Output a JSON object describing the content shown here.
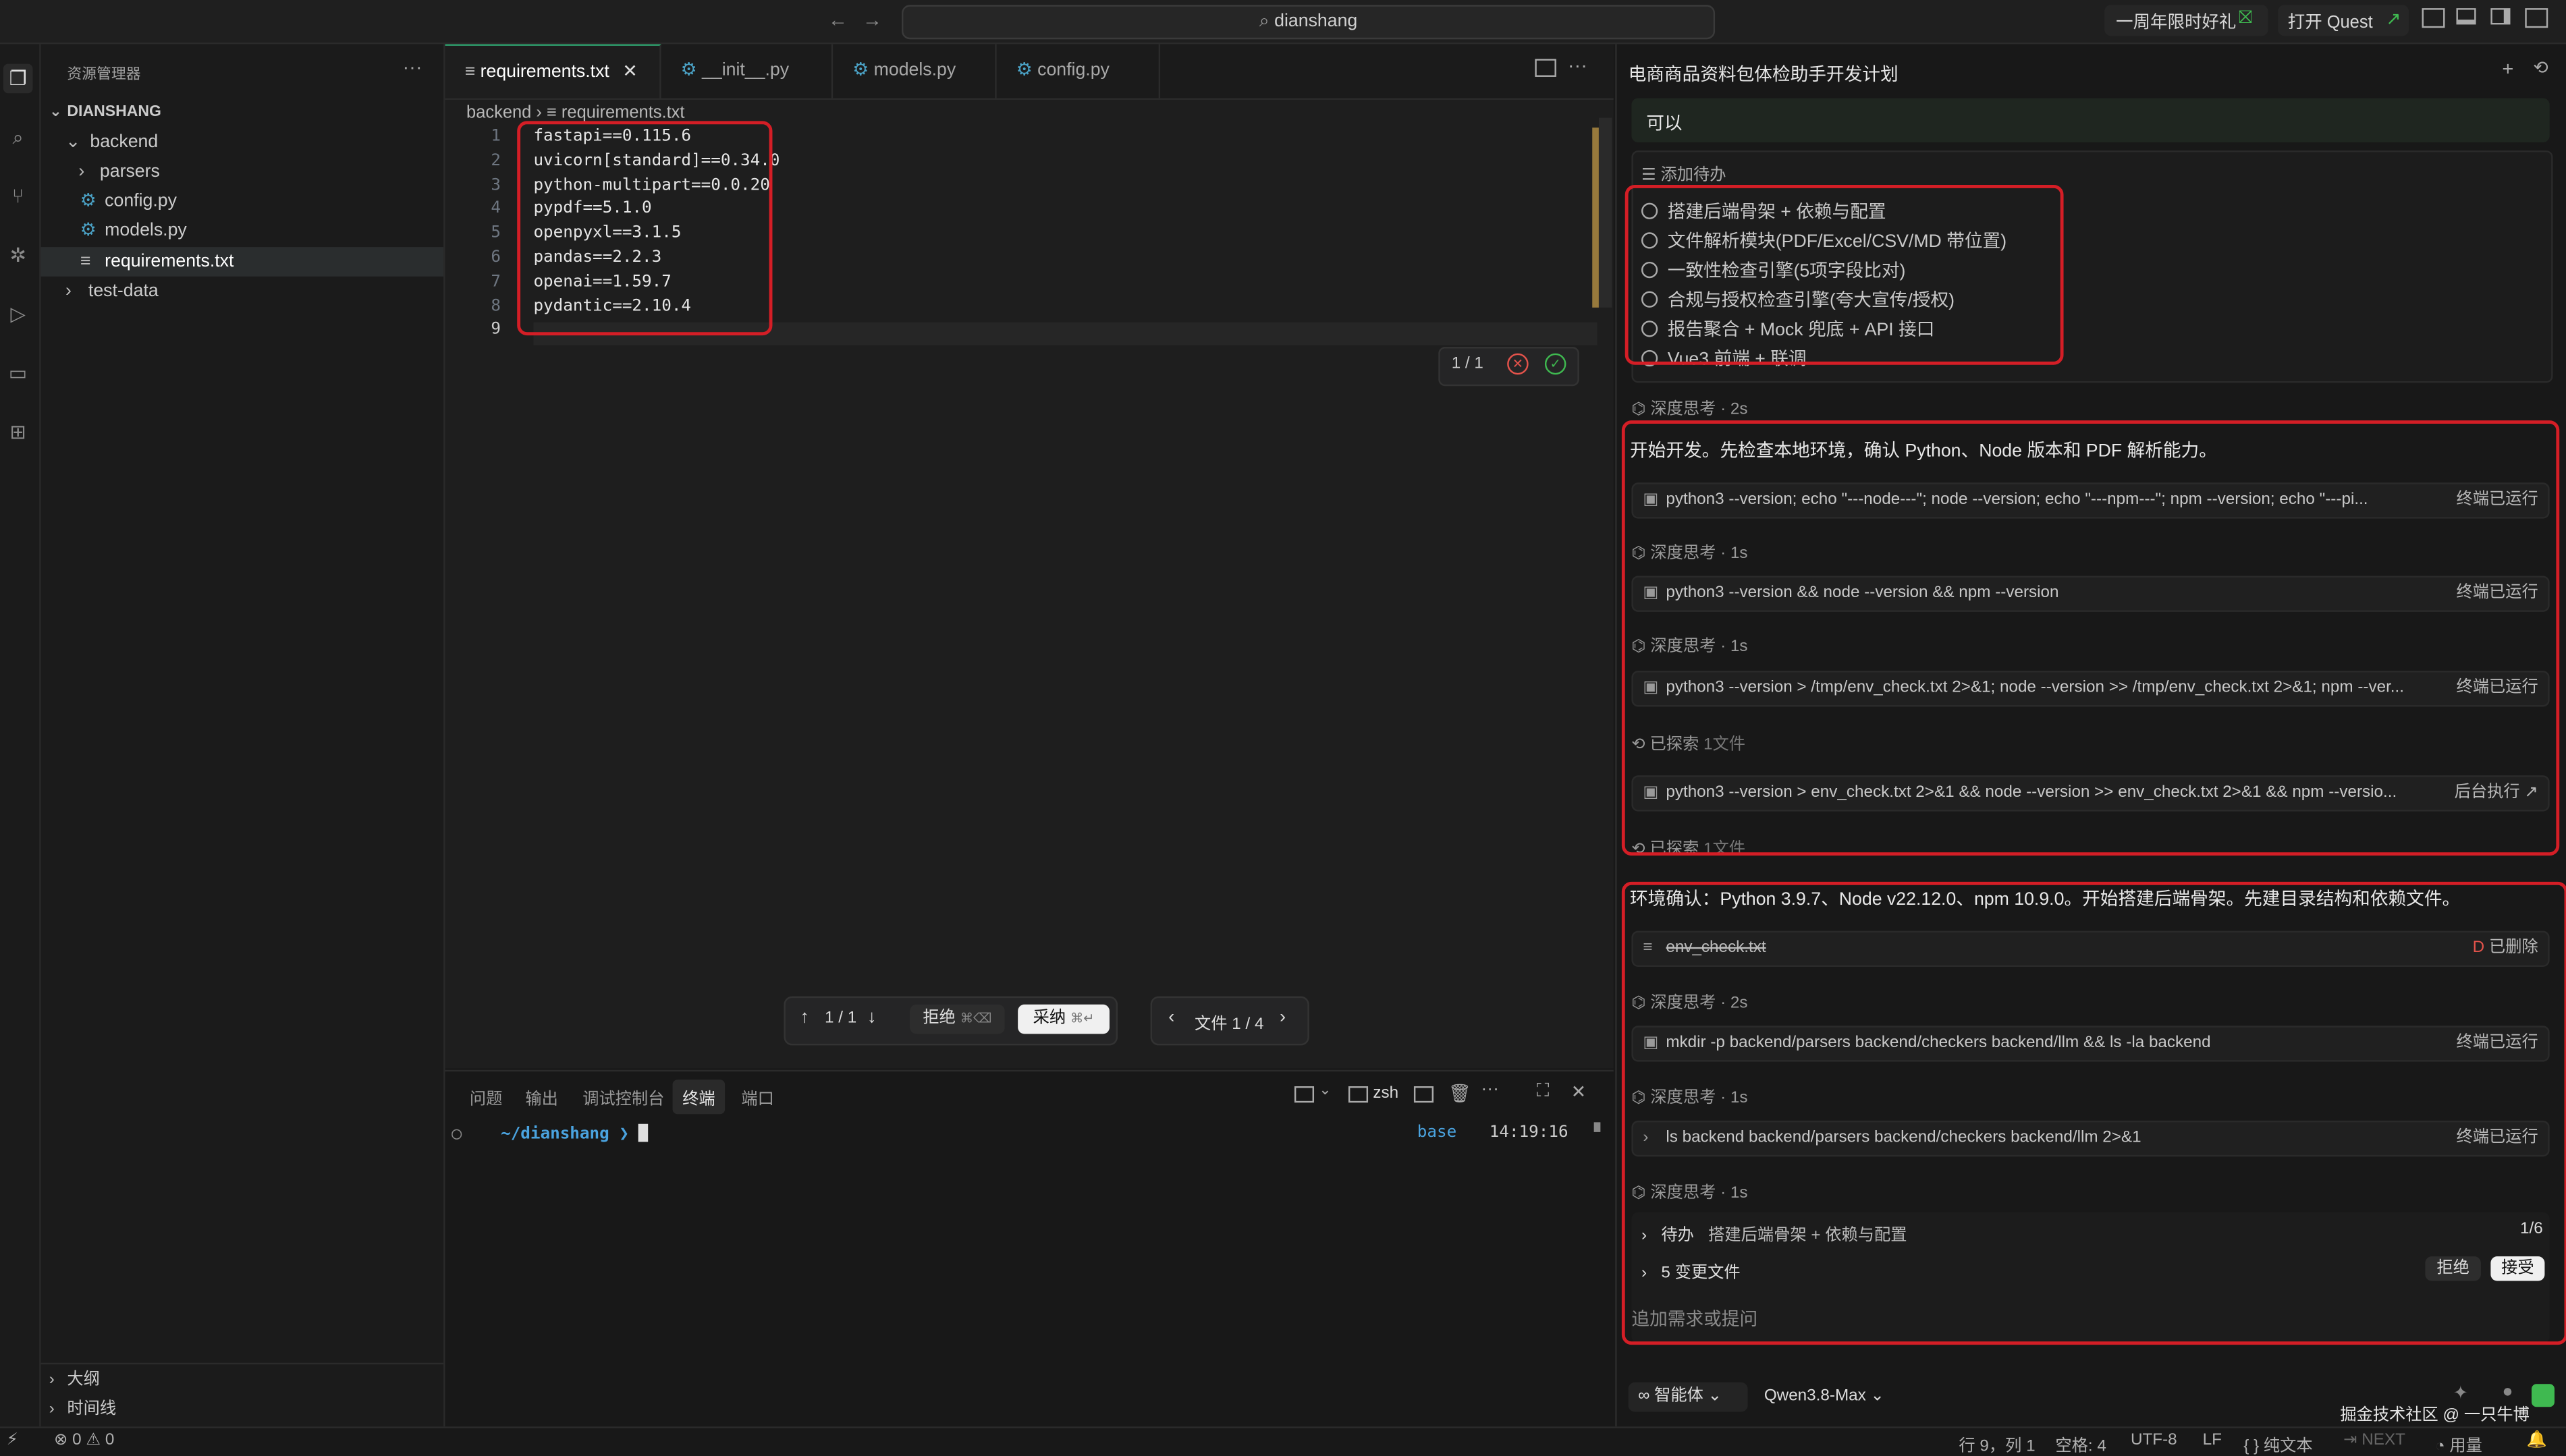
{
  "titlebar": {
    "search": "dianshang",
    "promo": "一周年限时好礼",
    "open_quest": "打开 Quest"
  },
  "explorer": {
    "title": "资源管理器",
    "root": "DIANSHANG",
    "items": [
      {
        "label": "backend"
      },
      {
        "label": "parsers"
      },
      {
        "label": "config.py"
      },
      {
        "label": "models.py"
      },
      {
        "label": "requirements.txt"
      },
      {
        "label": "test-data"
      }
    ],
    "outline": "大纲",
    "timeline": "时间线"
  },
  "editor": {
    "tabs": [
      {
        "label": "requirements.txt"
      },
      {
        "label": "__init__.py"
      },
      {
        "label": "models.py"
      },
      {
        "label": "config.py"
      }
    ],
    "breadcrumb": {
      "folder": "backend",
      "file": "requirements.txt"
    },
    "line_numbers": [
      "1",
      "2",
      "3",
      "4",
      "5",
      "6",
      "7",
      "8",
      "9"
    ],
    "lines": [
      "fastapi==0.115.6",
      "uvicorn[standard]==0.34.0",
      "python-multipart==0.0.20",
      "pypdf==5.1.0",
      "openpyxl==3.1.5",
      "pandas==2.2.3",
      "openai==1.59.7",
      "pydantic==2.10.4",
      ""
    ],
    "diff_counter": "1 / 1",
    "nav_counter": "1 / 1",
    "reject": "拒绝",
    "reject_shortcut": "⌘⌫",
    "accept": "采纳",
    "accept_shortcut": "⌘↵",
    "file_counter": "文件 1 / 4"
  },
  "panel": {
    "tabs": [
      "问题",
      "输出",
      "调试控制台",
      "终端",
      "端口"
    ],
    "shell": "zsh",
    "prompt_path": "~/dianshang",
    "env": "base",
    "time": "14:19:16"
  },
  "chat": {
    "title": "电商商品资料包体检助手开发计划",
    "reply_box": "可以",
    "todo_header": "添加待办",
    "todos": [
      "搭建后端骨架 + 依赖与配置",
      "文件解析模块(PDF/Excel/CSV/MD 带位置)",
      "一致性检查引擎(5项字段比对)",
      "合规与授权检查引擎(夸大宣传/授权)",
      "报告聚合 + Mock 兜底 + API 接口",
      "Vue3 前端 + 联调"
    ],
    "think_2s": "深度思考 · 2s",
    "think_1s": "深度思考 · 1s",
    "msg1": "开始开发。先检查本地环境，确认 Python、Node 版本和 PDF 解析能力。",
    "cmd1": "python3 --version; echo \"---node---\"; node --version; echo \"---npm---\"; npm --version; echo \"---pi...",
    "cmd2": "python3 --version && node --version && npm --version",
    "cmd3": "python3 --version > /tmp/env_check.txt 2>&1; node --version >> /tmp/env_check.txt 2>&1; npm --ver...",
    "cmd4": "python3 --version > env_check.txt 2>&1 && node --version >> env_check.txt 2>&1 && npm --versio...",
    "status_ran": "终端已运行",
    "status_bg": "后台执行",
    "explored": "已探索",
    "explored_count": "1文件",
    "msg2": "环境确认：Python 3.9.7、Node v22.12.0、npm 10.9.0。开始搭建后端骨架。先建目录结构和依赖文件。",
    "deleted_file": "env_check.txt",
    "deleted_flag": "D",
    "deleted_label": "已删除",
    "cmd5": "mkdir -p backend/parsers backend/checkers backend/llm && ls -la backend",
    "cmd6": "ls backend backend/parsers backend/checkers backend/llm 2>&1",
    "pending_label": "待办",
    "pending_task": "搭建后端骨架 + 依赖与配置",
    "pending_count": "1/6",
    "changes": "5 变更文件",
    "reject": "拒绝",
    "accept": "接受",
    "input_placeholder": "追加需求或提问",
    "mode": "智能体",
    "model": "Qwen3.8-Max"
  },
  "statusbar": {
    "errors": "0",
    "warnings": "0",
    "position": "行 9，列 1",
    "spaces": "空格: 4",
    "encoding": "UTF-8",
    "eol": "LF",
    "language": "{ } 纯文本",
    "next": "NEXT",
    "usage": "用量"
  },
  "watermark": "掘金技术社区 @ 一只牛博"
}
